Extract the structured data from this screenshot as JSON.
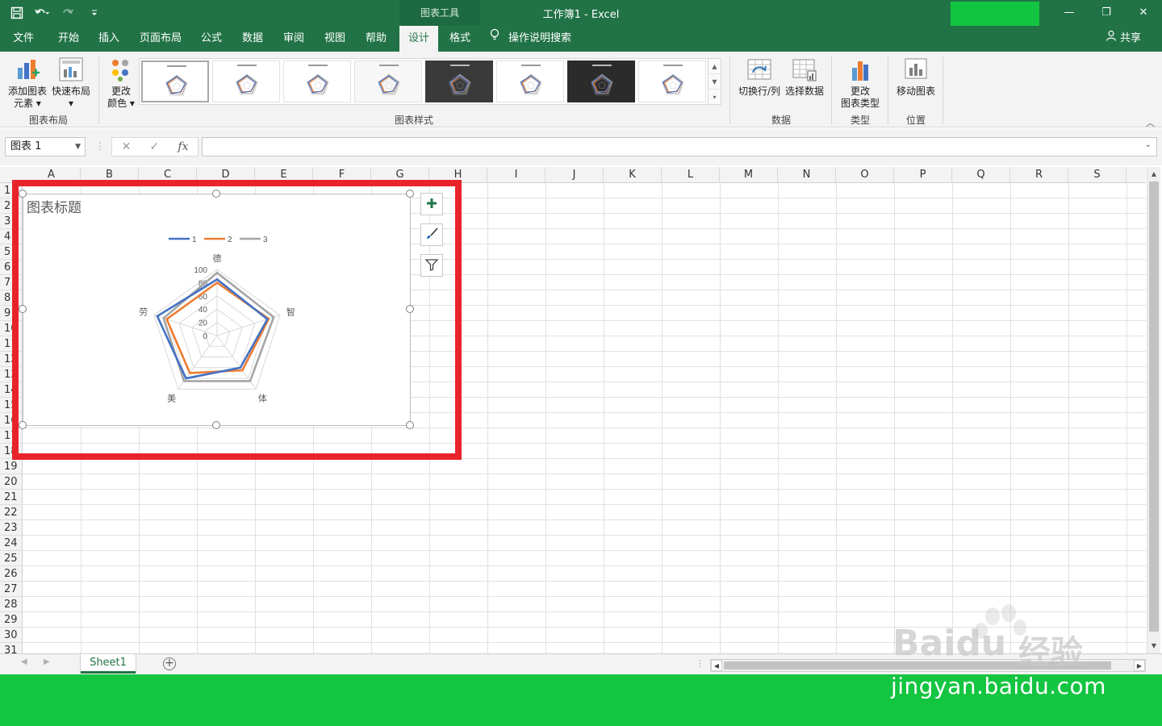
{
  "titlebar": {
    "context_title": "图表工具",
    "window_title": "工作簿1 - Excel",
    "qat": {
      "save_icon": "save-icon",
      "undo_icon": "undo-icon",
      "redo_icon": "redo-icon",
      "customize_icon": "chevron-down-icon"
    },
    "window_controls": {
      "minimize": "—",
      "restore": "❐",
      "close": "✕"
    }
  },
  "tabs": [
    {
      "id": "file",
      "label": "文件"
    },
    {
      "id": "home",
      "label": "开始"
    },
    {
      "id": "insert",
      "label": "插入"
    },
    {
      "id": "layout",
      "label": "页面布局"
    },
    {
      "id": "formulas",
      "label": "公式"
    },
    {
      "id": "data",
      "label": "数据"
    },
    {
      "id": "review",
      "label": "审阅"
    },
    {
      "id": "view",
      "label": "视图"
    },
    {
      "id": "help",
      "label": "帮助"
    },
    {
      "id": "design",
      "label": "设计",
      "active": true
    },
    {
      "id": "format",
      "label": "格式"
    }
  ],
  "tell_me": {
    "label": "操作说明搜索",
    "icon": "lightbulb-icon"
  },
  "share": {
    "label": "共享",
    "icon": "person-icon"
  },
  "ribbon": {
    "add_chart_element": {
      "line1": "添加图表",
      "line2": "元素"
    },
    "quick_layout": {
      "label": "快速布局"
    },
    "change_colors": {
      "line1": "更改",
      "line2": "颜色"
    },
    "switch_row_col": {
      "label": "切换行/列"
    },
    "select_data": {
      "label": "选择数据"
    },
    "change_chart_type": {
      "line1": "更改",
      "line2": "图表类型"
    },
    "move_chart": {
      "label": "移动图表"
    },
    "groups": {
      "chart_layouts": "图表布局",
      "chart_styles": "图表样式",
      "data": "数据",
      "type": "类型",
      "location": "位置"
    }
  },
  "formula_bar": {
    "name_box": "图表 1",
    "cancel": "✕",
    "enter": "✓",
    "fx": "fx",
    "value": ""
  },
  "sheet": {
    "columns": [
      "A",
      "B",
      "C",
      "D",
      "E",
      "F",
      "G",
      "H",
      "I",
      "J",
      "K",
      "L",
      "M",
      "N",
      "O",
      "P",
      "Q",
      "R",
      "S"
    ],
    "rows": [
      "1",
      "2",
      "3",
      "4",
      "5",
      "6",
      "7",
      "8",
      "9",
      "10",
      "11",
      "12",
      "13",
      "14",
      "15",
      "16",
      "17",
      "18",
      "19",
      "20",
      "21",
      "22",
      "23",
      "24",
      "25",
      "26",
      "27",
      "28",
      "29",
      "30",
      "31"
    ]
  },
  "chart": {
    "title": "图表标题",
    "side_buttons": {
      "elements": "plus-icon",
      "styles": "brush-icon",
      "filters": "filter-icon"
    }
  },
  "chart_data": {
    "type": "radar",
    "categories": [
      "德",
      "智",
      "体",
      "美",
      "劳"
    ],
    "series": [
      {
        "name": "1",
        "color": "#4472c4",
        "values": [
          85,
          80,
          60,
          80,
          95
        ]
      },
      {
        "name": "2",
        "color": "#ed7d31",
        "values": [
          80,
          82,
          65,
          70,
          80
        ]
      },
      {
        "name": "3",
        "color": "#a5a5a5",
        "values": [
          95,
          90,
          85,
          85,
          85
        ]
      }
    ],
    "axis_ticks": [
      "0",
      "20",
      "40",
      "60",
      "80",
      "100"
    ],
    "ylim": [
      0,
      100
    ],
    "legend_position": "top",
    "title": "图表标题"
  },
  "sheet_tabs": {
    "active": "Sheet1",
    "add_icon": "plus-icon"
  },
  "watermark": {
    "logo_latin": "Bai",
    "logo_du": "du",
    "logo_cn": "经验",
    "domain": "jingyan.baidu.com"
  },
  "colors": {
    "excel_green": "#217346",
    "highlight_red": "#e8232b",
    "footer_green": "#13c540"
  }
}
